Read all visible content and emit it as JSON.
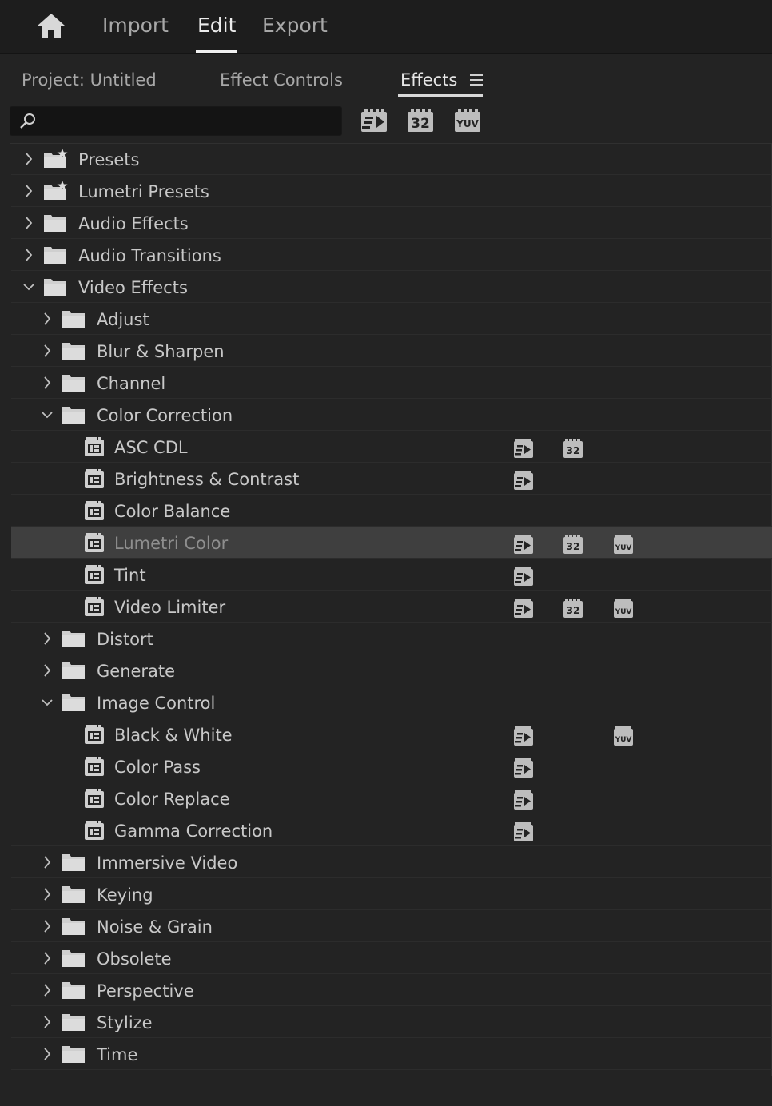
{
  "nav": {
    "home_icon": "home-icon",
    "tabs": [
      {
        "label": "Import",
        "active": false
      },
      {
        "label": "Edit",
        "active": true
      },
      {
        "label": "Export",
        "active": false
      }
    ]
  },
  "panel": {
    "tabs": [
      {
        "label": "Project: Untitled",
        "active": false
      },
      {
        "label": "Effect Controls",
        "active": false
      },
      {
        "label": "Effects",
        "active": true
      }
    ],
    "menu_icon": "hamburger-menu-icon"
  },
  "search": {
    "value": "",
    "placeholder": "",
    "icon": "magnifier-icon"
  },
  "filters": [
    {
      "name": "accelerated-effects-filter",
      "icon": "accelerated-icon"
    },
    {
      "name": "32-bit-color-filter",
      "label": "32"
    },
    {
      "name": "yuv-effects-filter",
      "label": "YUV"
    }
  ],
  "badge_labels": {
    "bit32": "32",
    "yuv": "YUV"
  },
  "tree": [
    {
      "label": "Presets",
      "type": "preset-folder",
      "level": 0,
      "expanded": false
    },
    {
      "label": "Lumetri Presets",
      "type": "preset-folder",
      "level": 0,
      "expanded": false
    },
    {
      "label": "Audio Effects",
      "type": "folder",
      "level": 0,
      "expanded": false
    },
    {
      "label": "Audio Transitions",
      "type": "folder",
      "level": 0,
      "expanded": false
    },
    {
      "label": "Video Effects",
      "type": "folder",
      "level": 0,
      "expanded": true
    },
    {
      "label": "Adjust",
      "type": "folder",
      "level": 1,
      "expanded": false
    },
    {
      "label": "Blur & Sharpen",
      "type": "folder",
      "level": 1,
      "expanded": false
    },
    {
      "label": "Channel",
      "type": "folder",
      "level": 1,
      "expanded": false
    },
    {
      "label": "Color Correction",
      "type": "folder",
      "level": 1,
      "expanded": true
    },
    {
      "label": "ASC CDL",
      "type": "effect",
      "level": 2,
      "accel": true,
      "bit32": true,
      "yuv": false
    },
    {
      "label": "Brightness & Contrast",
      "type": "effect",
      "level": 2,
      "accel": true,
      "bit32": false,
      "yuv": false
    },
    {
      "label": "Color Balance",
      "type": "effect",
      "level": 2,
      "accel": false,
      "bit32": false,
      "yuv": false
    },
    {
      "label": "Lumetri Color",
      "type": "effect",
      "level": 2,
      "accel": true,
      "bit32": true,
      "yuv": true,
      "selected": true
    },
    {
      "label": "Tint",
      "type": "effect",
      "level": 2,
      "accel": true,
      "bit32": false,
      "yuv": false
    },
    {
      "label": "Video Limiter",
      "type": "effect",
      "level": 2,
      "accel": true,
      "bit32": true,
      "yuv": true
    },
    {
      "label": "Distort",
      "type": "folder",
      "level": 1,
      "expanded": false
    },
    {
      "label": "Generate",
      "type": "folder",
      "level": 1,
      "expanded": false
    },
    {
      "label": "Image Control",
      "type": "folder",
      "level": 1,
      "expanded": true
    },
    {
      "label": "Black & White",
      "type": "effect",
      "level": 2,
      "accel": true,
      "bit32": false,
      "yuv": true
    },
    {
      "label": "Color Pass",
      "type": "effect",
      "level": 2,
      "accel": true,
      "bit32": false,
      "yuv": false
    },
    {
      "label": "Color Replace",
      "type": "effect",
      "level": 2,
      "accel": true,
      "bit32": false,
      "yuv": false
    },
    {
      "label": "Gamma Correction",
      "type": "effect",
      "level": 2,
      "accel": true,
      "bit32": false,
      "yuv": false
    },
    {
      "label": "Immersive Video",
      "type": "folder",
      "level": 1,
      "expanded": false
    },
    {
      "label": "Keying",
      "type": "folder",
      "level": 1,
      "expanded": false
    },
    {
      "label": "Noise & Grain",
      "type": "folder",
      "level": 1,
      "expanded": false
    },
    {
      "label": "Obsolete",
      "type": "folder",
      "level": 1,
      "expanded": false
    },
    {
      "label": "Perspective",
      "type": "folder",
      "level": 1,
      "expanded": false
    },
    {
      "label": "Stylize",
      "type": "folder",
      "level": 1,
      "expanded": false
    },
    {
      "label": "Time",
      "type": "folder",
      "level": 1,
      "expanded": false
    }
  ],
  "colors": {
    "background": "#232323",
    "topbar": "#1d1d1d",
    "selected_row": "#3f3f3f",
    "text": "#c8c8c8"
  }
}
